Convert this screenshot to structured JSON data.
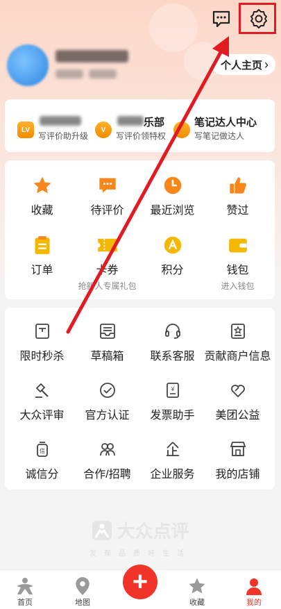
{
  "header": {
    "message_icon": "message-icon",
    "settings_icon": "gear-icon"
  },
  "profile": {
    "home_label": "个人主页",
    "home_chevron": "›"
  },
  "levels": [
    {
      "badge": "LV",
      "title": "",
      "sub": "写评价助升级"
    },
    {
      "badge": "V",
      "title": "乐部",
      "sub": "写评价领特权"
    },
    {
      "badge": "",
      "title": "笔记达人中心",
      "sub": "写笔记做达人"
    }
  ],
  "main_grid": [
    {
      "icon": "star-icon",
      "label": "收藏",
      "sub": ""
    },
    {
      "icon": "pending-review-icon",
      "label": "待评价",
      "sub": ""
    },
    {
      "icon": "clock-icon",
      "label": "最近浏览",
      "sub": ""
    },
    {
      "icon": "thumbs-up-icon",
      "label": "赞过",
      "sub": ""
    },
    {
      "icon": "order-icon",
      "label": "订单",
      "sub": ""
    },
    {
      "icon": "coupon-icon",
      "label": "卡券",
      "sub": "抢新人专属礼包"
    },
    {
      "icon": "points-icon",
      "label": "积分",
      "sub": ""
    },
    {
      "icon": "wallet-icon",
      "label": "钱包",
      "sub": "进入钱包"
    }
  ],
  "service_grid": [
    {
      "icon": "flash-sale-icon",
      "label": "限时秒杀"
    },
    {
      "icon": "draft-box-icon",
      "label": "草稿箱"
    },
    {
      "icon": "headset-icon",
      "label": "联系客服"
    },
    {
      "icon": "merchant-info-icon",
      "label": "贡献商户信息"
    },
    {
      "icon": "gavel-icon",
      "label": "大众评审"
    },
    {
      "icon": "verified-icon",
      "label": "官方认证"
    },
    {
      "icon": "invoice-icon",
      "label": "发票助手"
    },
    {
      "icon": "charity-icon",
      "label": "美团公益"
    },
    {
      "icon": "credit-score-icon",
      "label": "诚信分"
    },
    {
      "icon": "cooperation-icon",
      "label": "合作/招聘"
    },
    {
      "icon": "enterprise-icon",
      "label": "企业服务"
    },
    {
      "icon": "shop-icon",
      "label": "我的店铺"
    }
  ],
  "brand": {
    "name": "大众点评",
    "slogan": "发现品质好生活"
  },
  "bottom_nav": [
    {
      "icon": "home-icon",
      "label": "首页"
    },
    {
      "icon": "map-icon",
      "label": "地图"
    },
    {
      "icon": "plus-icon",
      "label": "+"
    },
    {
      "icon": "favorites-icon",
      "label": "收藏"
    },
    {
      "icon": "mine-icon",
      "label": "我的"
    }
  ],
  "colors": {
    "accent": "#f0342a",
    "orange": "#f7861b",
    "highlight_box": "#e21a22"
  }
}
